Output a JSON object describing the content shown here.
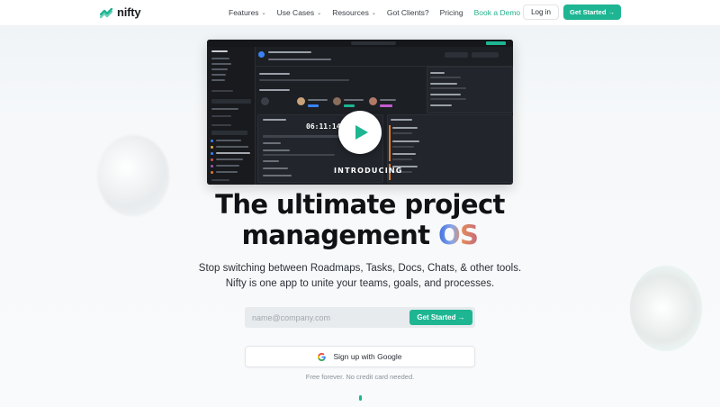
{
  "brand": {
    "name": "nifty",
    "accent": "#1eb592"
  },
  "nav": {
    "links": [
      {
        "label": "Features",
        "has_dropdown": true
      },
      {
        "label": "Use Cases",
        "has_dropdown": true
      },
      {
        "label": "Resources",
        "has_dropdown": true
      },
      {
        "label": "Got Clients?",
        "has_dropdown": false
      },
      {
        "label": "Pricing",
        "has_dropdown": false
      },
      {
        "label": "Book a Demo",
        "has_dropdown": false
      }
    ],
    "login_label": "Log in",
    "cta_label": "Get Started →"
  },
  "video": {
    "timer": "06:11:14",
    "caption": "INTRODUCING",
    "play_icon": "play-icon"
  },
  "hero": {
    "headline_line1": "The ultimate project",
    "headline_line2_prefix": "management ",
    "headline_line2_highlight": "OS",
    "subheadline_line1": "Stop switching between Roadmaps, Tasks, Docs, Chats, & other tools.",
    "subheadline_line2": "Nifty is one app to unite your teams, goals, and processes."
  },
  "signup": {
    "email_placeholder": "name@company.com",
    "email_value": "",
    "cta_label": "Get Started →",
    "google_label": "Sign up with Google",
    "fineprint": "Free forever. No credit card needed."
  }
}
